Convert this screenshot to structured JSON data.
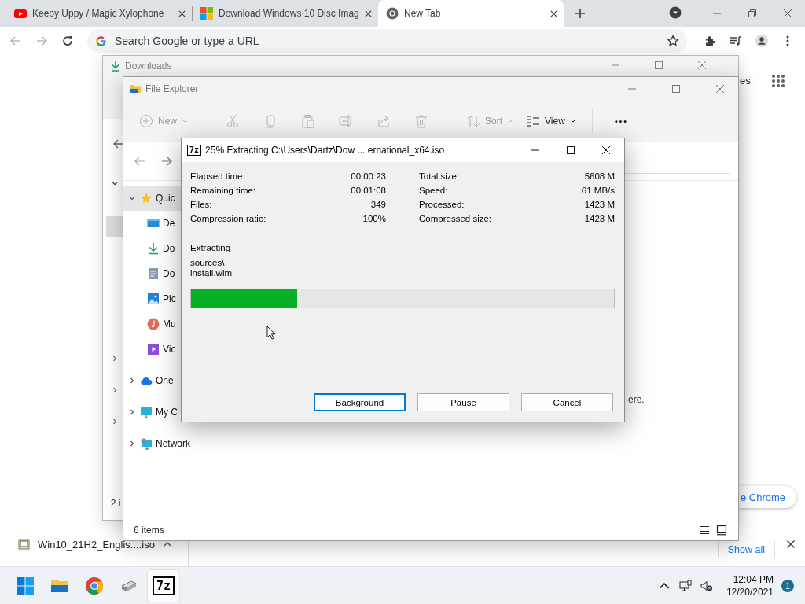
{
  "browser": {
    "tabs": [
      {
        "kind": "video",
        "title": "Keepy Uppy / Magic Xylophone",
        "selected": false
      },
      {
        "kind": "microsoft",
        "title": "Download Windows 10 Disc Imag",
        "selected": false
      },
      {
        "kind": "newtab",
        "title": "New Tab",
        "selected": true
      }
    ],
    "omnibox": {
      "placeholder": "Search Google or type a URL"
    }
  },
  "new_tab_page": {
    "link_fragment": "es",
    "customize_button": "e Chrome"
  },
  "downloads_window": {
    "title": "Downloads",
    "status": "2 i"
  },
  "file_explorer": {
    "title": "File Explorer",
    "toolbar": [
      {
        "kind": "new",
        "label": "New",
        "disabled": true
      },
      {
        "kind": "separator"
      },
      {
        "kind": "cut",
        "disabled": true
      },
      {
        "kind": "copy",
        "disabled": true
      },
      {
        "kind": "paste",
        "disabled": true
      },
      {
        "kind": "rename",
        "disabled": true
      },
      {
        "kind": "share",
        "disabled": true
      },
      {
        "kind": "delete",
        "disabled": true
      },
      {
        "kind": "separator"
      },
      {
        "kind": "sort",
        "label": "Sort",
        "disabled": true
      },
      {
        "kind": "view",
        "label": "View",
        "disabled": false
      },
      {
        "kind": "separator"
      },
      {
        "kind": "more",
        "disabled": false
      }
    ],
    "tree": [
      {
        "kind": "star",
        "label": "Quic",
        "expanded": true,
        "selected": true,
        "children": [
          {
            "kind": "desktop",
            "label": "De",
            "selected": false
          },
          {
            "kind": "download",
            "label": "Do",
            "selected": false
          },
          {
            "kind": "document",
            "label": "Do",
            "selected": false
          },
          {
            "kind": "pictures",
            "label": "Pic",
            "selected": false
          },
          {
            "kind": "music",
            "label": "Mu",
            "selected": false
          },
          {
            "kind": "videos",
            "label": "Vic",
            "selected": false
          }
        ]
      },
      {
        "kind": "cloud",
        "label": "One",
        "expanded": false,
        "selected": false
      },
      {
        "kind": "computer",
        "label": "My C",
        "expanded": false,
        "selected": false
      },
      {
        "kind": "network",
        "label": "Network",
        "expanded": false,
        "selected": false
      }
    ],
    "message": "ere.",
    "status": "6 items"
  },
  "dialog": {
    "icon_text": "7z",
    "title": "25% Extracting C:\\Users\\Dartz\\Dow ... ernational_x64.iso",
    "stats_left": [
      {
        "label": "Elapsed time:",
        "value": "00:00:23"
      },
      {
        "label": "Remaining time:",
        "value": "00:01:08"
      },
      {
        "label": "Files:",
        "value": "349"
      },
      {
        "label": "Compression ratio:",
        "value": "100%"
      }
    ],
    "stats_right": [
      {
        "label": "Total size:",
        "value": "5608 M"
      },
      {
        "label": "Speed:",
        "value": "61 MB/s"
      },
      {
        "label": "Processed:",
        "value": "1423 M"
      },
      {
        "label": "Compressed size:",
        "value": "1423 M"
      }
    ],
    "action": "Extracting",
    "path": [
      "sources\\",
      "install.wim"
    ],
    "progress": {
      "level": 0.25
    },
    "buttons": [
      {
        "label": "Background",
        "default": true
      },
      {
        "label": "Pause",
        "default": false
      },
      {
        "label": "Cancel",
        "default": false
      }
    ]
  },
  "download_shelf": {
    "file": "Win10_21H2_Englis....iso",
    "show_all": "Show all"
  },
  "taskbar": {
    "apps": [
      {
        "kind": "start",
        "selected": false
      },
      {
        "kind": "explorer",
        "selected": false
      },
      {
        "kind": "chrome",
        "selected": false
      },
      {
        "kind": "usb",
        "selected": false
      },
      {
        "kind": "sevenzip",
        "text": "7z",
        "selected": true
      }
    ],
    "time": "12:04 PM",
    "date": "12/20/2021",
    "badge": "1"
  }
}
